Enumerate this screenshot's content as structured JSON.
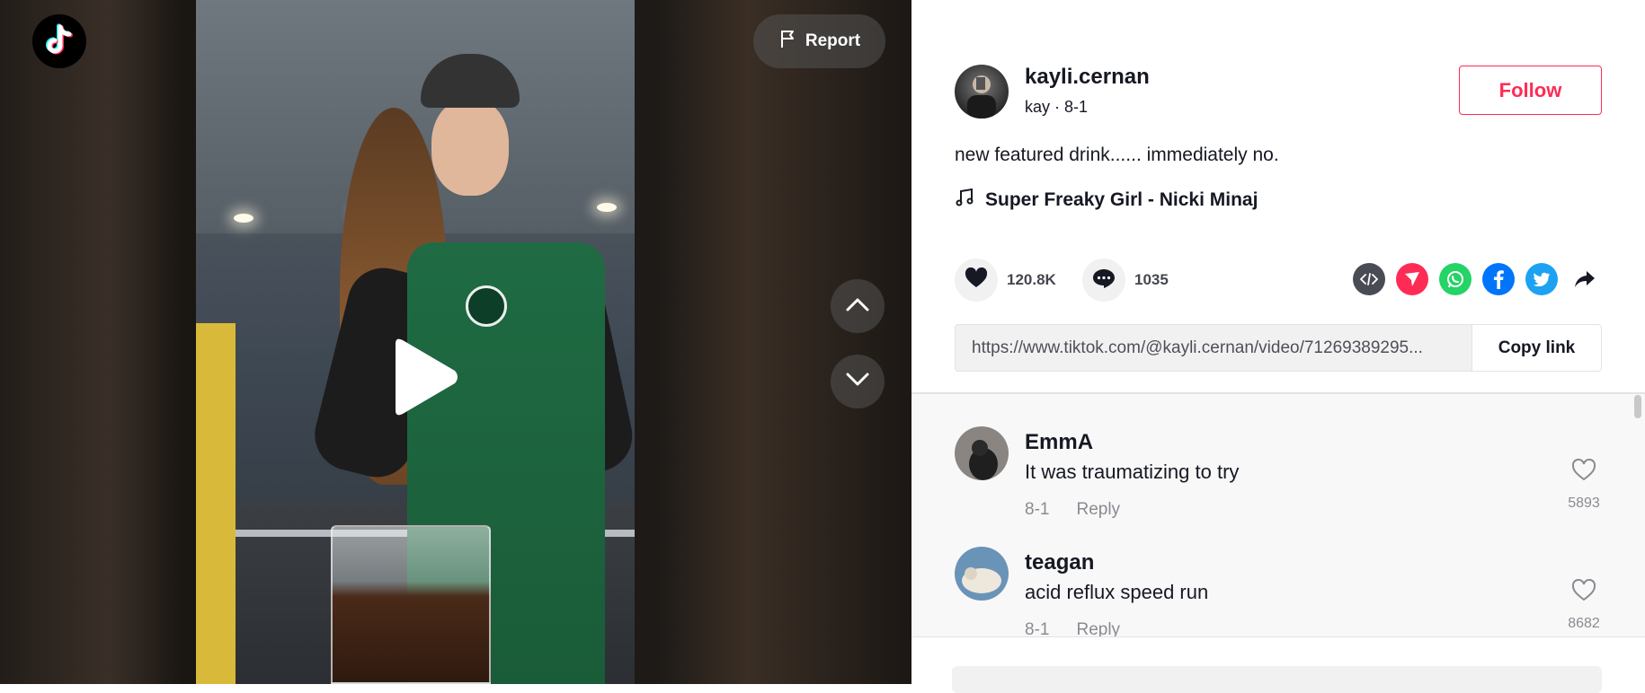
{
  "video": {
    "report_label": "Report",
    "icons": {
      "logo": "tiktok-logo-icon",
      "report": "flag-icon",
      "play": "play-icon",
      "prev": "chevron-up-icon",
      "next": "chevron-down-icon"
    }
  },
  "author": {
    "username": "kayli.cernan",
    "nickname": "kay",
    "date": "8-1",
    "subline": "kay · 8-1",
    "follow_label": "Follow"
  },
  "post": {
    "caption": "new featured drink...... immediately no.",
    "music": "Super Freaky Girl - Nicki Minaj",
    "likes": "120.8K",
    "comments": "1035",
    "link": "https://www.tiktok.com/@kayli.cernan/video/71269389295...",
    "copy_label": "Copy link",
    "share_icons": [
      "embed-icon",
      "send-icon",
      "whatsapp-icon",
      "facebook-icon",
      "twitter-icon",
      "share-arrow-icon"
    ]
  },
  "comments": [
    {
      "name": "EmmA",
      "text": "It was traumatizing to try",
      "date": "8-1",
      "reply": "Reply",
      "likes": "5893"
    },
    {
      "name": "teagan",
      "text": "acid reflux speed run",
      "date": "8-1",
      "reply": "Reply",
      "likes": "8682"
    }
  ],
  "colors": {
    "accent": "#fe2c55",
    "text": "#161823",
    "muted": "#8a8b91",
    "whatsapp": "#25d366",
    "facebook": "#0075fa",
    "twitter": "#1da1f2",
    "send": "#fe2c55",
    "embed": "#4a4c55"
  }
}
